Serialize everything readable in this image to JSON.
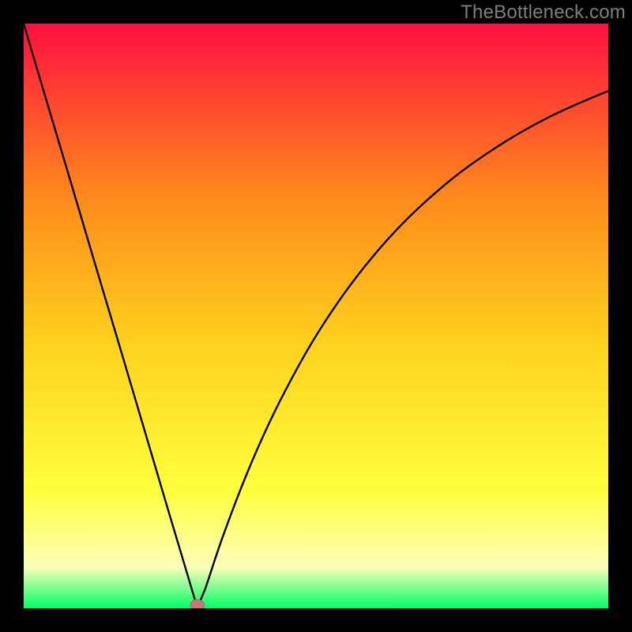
{
  "watermark": "TheBottleneck.com",
  "colors": {
    "frame": "#000000",
    "curve": "#000000",
    "marker_fill": "#c77777",
    "marker_stroke": "#b56666",
    "grad_top": "#ff0f3f",
    "grad_q1": "#ff8b1b",
    "grad_mid": "#ffd21c",
    "grad_q3": "#ffff3d",
    "grad_band": "#fbffb8",
    "grad_bottom": "#00ff66"
  },
  "chart_data": {
    "type": "line",
    "title": "",
    "xlabel": "",
    "ylabel": "",
    "x_range": [
      0,
      100
    ],
    "y_range": [
      0,
      100
    ],
    "x": [
      0,
      4,
      8,
      12,
      16,
      20,
      24,
      28,
      29.7,
      31,
      34,
      38,
      42,
      46,
      50,
      55,
      60,
      65,
      70,
      75,
      80,
      85,
      90,
      95,
      100
    ],
    "y": [
      100,
      86.5,
      73.1,
      59.6,
      46.2,
      32.7,
      19.2,
      5.8,
      0.1,
      3.2,
      12.1,
      22.6,
      31.7,
      39.6,
      46.6,
      54.1,
      60.5,
      66.0,
      70.7,
      74.8,
      78.3,
      81.4,
      84.1,
      86.4,
      88.5
    ],
    "marker": {
      "x": 29.7,
      "y": 0.6,
      "rx": 1.2,
      "ry": 0.9
    },
    "curve_description": "V-shaped curve with sharp minimum near x≈30, steeper rise on left than right",
    "background_gradient_description": "Vertical gradient red→orange→yellow→pale→green (top to bottom)"
  }
}
